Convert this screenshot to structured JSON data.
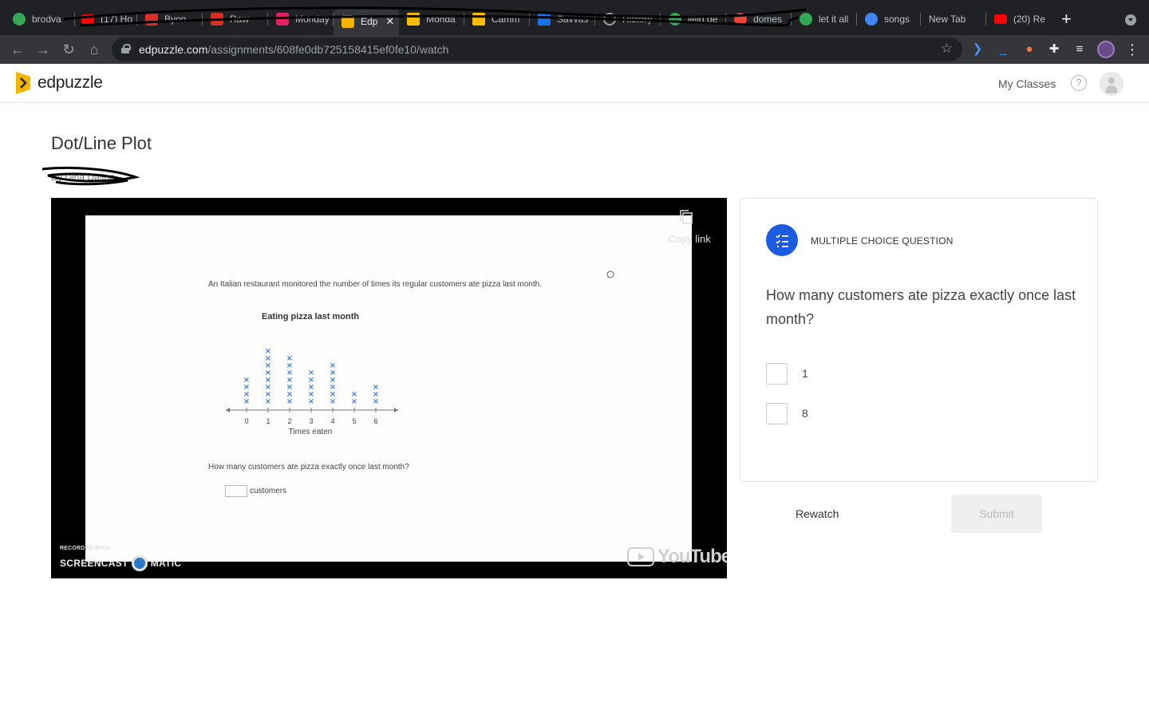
{
  "browser": {
    "tabs": [
      {
        "label": "brodva",
        "fav": "#34a853"
      },
      {
        "label": "(17) Ho",
        "fav": "#ff0000"
      },
      {
        "label": "Byon",
        "fav": "#d93025"
      },
      {
        "label": "Raw",
        "fav": "#d93025"
      },
      {
        "label": "Monday",
        "fav": "#e91e63"
      },
      {
        "label": "Edp",
        "fav": "#f5b400",
        "active": true
      },
      {
        "label": "Monda",
        "fav": "#fbbc04"
      },
      {
        "label": "Camm",
        "fav": "#fbbc04"
      },
      {
        "label": "Savvas",
        "fav": "#1a73e8"
      },
      {
        "label": "History",
        "fav": "#9aa0a6"
      },
      {
        "label": "wild de",
        "fav": "#34a853"
      },
      {
        "label": "domes",
        "fav": "#ea4335"
      },
      {
        "label": "let it all",
        "fav": "#34a853"
      },
      {
        "label": "songs",
        "fav": "#4285f4"
      },
      {
        "label": "New Tab",
        "fav": ""
      },
      {
        "label": "(20) Re",
        "fav": "#ff0000"
      }
    ],
    "url_host": "edpuzzle.com",
    "url_path": "/assignments/608fe0db725158415ef0fe10/watch"
  },
  "header": {
    "logo_text": "edpuzzle",
    "my_classes": "My Classes",
    "help": "?"
  },
  "assignment": {
    "title": "Dot/Line Plot",
    "byline": "By Dina Dalton"
  },
  "video": {
    "copy_link": "Copy link",
    "slide_text": "An Italian restaurant monitored the number of times its regular customers ate pizza last month.",
    "slide_question": "How many customers ate pizza exactly once last month?",
    "answer_unit": "customers",
    "recorded_with": "RECORDED WITH",
    "screencast_left": "SCREENCAST",
    "screencast_right": "MATIC",
    "youtube": "YouTube"
  },
  "chart_data": {
    "type": "scatter",
    "title": "Eating pizza last month",
    "xlabel": "Times eaten",
    "ylabel": "",
    "categories": [
      "0",
      "1",
      "2",
      "3",
      "4",
      "5",
      "6"
    ],
    "values": [
      4,
      8,
      7,
      5,
      6,
      2,
      3
    ],
    "mark": "x",
    "color": "#3b7ddd"
  },
  "question": {
    "type_label": "MULTIPLE CHOICE QUESTION",
    "text": "How many customers ate pizza exactly once last month?",
    "options": [
      {
        "label": "1"
      },
      {
        "label": "8"
      }
    ]
  },
  "actions": {
    "rewatch": "Rewatch",
    "submit": "Submit"
  },
  "colors": {
    "accent": "#1a5be0",
    "logo": "#f5b400"
  }
}
